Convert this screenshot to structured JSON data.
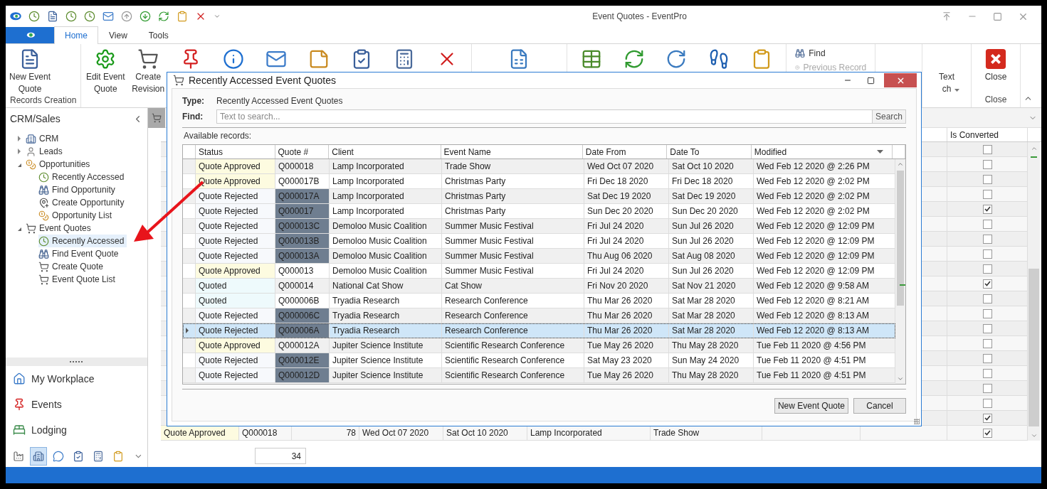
{
  "window": {
    "title": "Event Quotes - EventPro"
  },
  "quick_access": [
    {
      "kind": "logo"
    },
    {
      "kind": "clock"
    },
    {
      "kind": "document"
    },
    {
      "kind": "clock"
    },
    {
      "kind": "clock"
    },
    {
      "kind": "mail"
    },
    {
      "kind": "up-circle"
    },
    {
      "kind": "down-circle"
    },
    {
      "kind": "refresh"
    },
    {
      "kind": "clipboard"
    },
    {
      "kind": "delete"
    },
    {
      "kind": "dropdown"
    }
  ],
  "ribbon_tabs": [
    {
      "label": "Home",
      "selected": true
    },
    {
      "label": "View",
      "selected": false
    },
    {
      "label": "Tools",
      "selected": false
    }
  ],
  "ribbon_groups": [
    {
      "label": "Records Creation",
      "buttons": [
        {
          "kind": "document",
          "lines": [
            "New Event",
            "Quote"
          ]
        }
      ]
    },
    {
      "buttons": [
        {
          "kind": "gear",
          "lines": [
            "Edit Event",
            "Quote"
          ]
        },
        {
          "kind": "cart",
          "lines": [
            "Create",
            "Revision"
          ]
        },
        {
          "kind": "pin"
        },
        {
          "kind": "info"
        },
        {
          "kind": "mail"
        },
        {
          "kind": "note"
        },
        {
          "kind": "clipboard-check"
        },
        {
          "kind": "calculator"
        },
        {
          "kind": "delete"
        }
      ]
    },
    {
      "buttons": [
        {
          "kind": "report"
        }
      ]
    },
    {
      "buttons": [
        {
          "kind": "grid"
        },
        {
          "kind": "refresh"
        },
        {
          "kind": "window-refresh"
        },
        {
          "kind": "footprints"
        },
        {
          "kind": "clipboard"
        }
      ]
    },
    {
      "small_buttons": [
        {
          "kind": "binoculars",
          "label": "Find",
          "disabled": false
        },
        {
          "kind": "previous",
          "label": "Previous Record",
          "disabled": true
        }
      ]
    },
    {
      "buttons": [
        {
          "kind": "none",
          "lines": [
            "Text",
            "ch"
          ],
          "dropdown": true
        }
      ]
    },
    {
      "label": "Close",
      "buttons": [
        {
          "kind": "close-box",
          "lines": [
            "Close"
          ]
        }
      ]
    }
  ],
  "sidebar": {
    "title": "CRM/Sales",
    "tree": [
      {
        "label": "CRM",
        "kind": "building-person",
        "expanded": false,
        "selected": false
      },
      {
        "label": "Leads",
        "kind": "person",
        "expanded": false,
        "selected": false
      },
      {
        "label": "Opportunities",
        "kind": "coins",
        "expanded": true,
        "selected": false,
        "children": [
          {
            "label": "Recently Accessed",
            "kind": "clock",
            "selected": false
          },
          {
            "label": "Find Opportunity",
            "kind": "binoculars",
            "selected": false
          },
          {
            "label": "Create Opportunity",
            "kind": "pin-add",
            "selected": false
          },
          {
            "label": "Opportunity List",
            "kind": "coins",
            "selected": false
          }
        ]
      },
      {
        "label": "Event Quotes",
        "kind": "cart",
        "expanded": true,
        "selected": false,
        "children": [
          {
            "label": "Recently Accessed",
            "kind": "clock",
            "selected": true
          },
          {
            "label": "Find Event Quote",
            "kind": "binoculars",
            "selected": false
          },
          {
            "label": "Create Quote",
            "kind": "cart",
            "selected": false
          },
          {
            "label": "Event Quote List",
            "kind": "cart",
            "selected": false
          }
        ]
      }
    ],
    "nav": [
      {
        "label": "My Workplace",
        "kind": "house"
      },
      {
        "label": "Events",
        "kind": "pin"
      },
      {
        "label": "Lodging",
        "kind": "bed"
      }
    ],
    "icon_bar": [
      {
        "kind": "factory",
        "selected": false
      },
      {
        "kind": "building-person",
        "selected": true
      },
      {
        "kind": "chat",
        "selected": false
      },
      {
        "kind": "clipboard-check",
        "selected": false
      },
      {
        "kind": "calculator",
        "selected": false
      },
      {
        "kind": "clipboard",
        "selected": false
      }
    ]
  },
  "background_grid": {
    "converted_header": "Is Converted",
    "rows": [
      {
        "is_converted": false
      },
      {
        "is_converted": false
      },
      {
        "is_converted": false
      },
      {
        "is_converted": false
      },
      {
        "is_converted": true
      },
      {
        "is_converted": false
      },
      {
        "is_converted": false
      },
      {
        "is_converted": false
      },
      {
        "is_converted": false
      },
      {
        "is_converted": true
      },
      {
        "is_converted": false
      },
      {
        "is_converted": false
      },
      {
        "is_converted": false
      },
      {
        "is_converted": false
      },
      {
        "is_converted": false
      },
      {
        "is_converted": false
      },
      {
        "is_converted": false
      },
      {
        "is_converted": false
      },
      {
        "is_converted": true
      },
      {
        "is_converted": true,
        "kind": "approved",
        "cells": [
          "Quote Approved",
          "Q000018",
          "78",
          "Wed Oct 07 2020",
          "Sat Oct 10 2020",
          "Lamp Incorporated",
          "Trade Show"
        ]
      }
    ],
    "footer_count": "34"
  },
  "dialog": {
    "title": "Recently Accessed Event Quotes",
    "type_label": "Type:",
    "type_value": "Recently Accessed Event Quotes",
    "find_label": "Find:",
    "find_placeholder": "Text to search...",
    "search_button": "Search",
    "records_label": "Available records:",
    "columns": [
      "Status",
      "Quote #",
      "Client",
      "Event Name",
      "Date From",
      "Date To",
      "Modified"
    ],
    "rows": [
      {
        "kind": "approved",
        "selected": false,
        "cells": [
          "Quote Approved",
          "Q000018",
          "Lamp Incorporated",
          "Trade Show",
          "Wed Oct 07 2020",
          "Sat Oct 10 2020",
          "Wed Feb 12 2020 @ 2:26 PM"
        ]
      },
      {
        "kind": "approved",
        "selected": false,
        "cells": [
          "Quote Approved",
          "Q000017B",
          "Lamp Incorporated",
          "Christmas Party",
          "Fri Dec 18 2020",
          "Fri Dec 18 2020",
          "Wed Feb 12 2020 @ 2:02 PM"
        ]
      },
      {
        "kind": "rejected",
        "selected": false,
        "cells": [
          "Quote Rejected",
          "Q000017A",
          "Lamp Incorporated",
          "Christmas Party",
          "Sat Dec 19 2020",
          "Sat Dec 19 2020",
          "Wed Feb 12 2020 @ 2:02 PM"
        ]
      },
      {
        "kind": "rejected",
        "selected": false,
        "cells": [
          "Quote Rejected",
          "Q000017",
          "Lamp Incorporated",
          "Christmas Party",
          "Sun Dec 20 2020",
          "Sun Dec 20 2020",
          "Wed Feb 12 2020 @ 2:02 PM"
        ]
      },
      {
        "kind": "rejected",
        "selected": false,
        "cells": [
          "Quote Rejected",
          "Q000013C",
          "Demoloo Music Coalition",
          "Summer Music Festival",
          "Fri Jul 24 2020",
          "Sun Jul 26 2020",
          "Wed Feb 12 2020 @ 12:09 PM"
        ]
      },
      {
        "kind": "rejected",
        "selected": false,
        "cells": [
          "Quote Rejected",
          "Q000013B",
          "Demoloo Music Coalition",
          "Summer Music Festival",
          "Fri Jul 24 2020",
          "Sun Jul 26 2020",
          "Wed Feb 12 2020 @ 12:09 PM"
        ]
      },
      {
        "kind": "rejected",
        "selected": false,
        "cells": [
          "Quote Rejected",
          "Q000013A",
          "Demoloo Music Coalition",
          "Summer Music Festival",
          "Thu Aug 06 2020",
          "Sat Aug 08 2020",
          "Wed Feb 12 2020 @ 12:09 PM"
        ]
      },
      {
        "kind": "approved",
        "selected": false,
        "cells": [
          "Quote Approved",
          "Q000013",
          "Demoloo Music Coalition",
          "Summer Music Festival",
          "Fri Jul 24 2020",
          "Sun Jul 26 2020",
          "Wed Feb 12 2020 @ 12:09 PM"
        ]
      },
      {
        "kind": "quoted",
        "selected": false,
        "cells": [
          "Quoted",
          "Q000014",
          "National Cat Show",
          "Cat Show",
          "Fri Nov 20 2020",
          "Sat Nov 21 2020",
          "Wed Feb 12 2020 @ 9:58 AM"
        ]
      },
      {
        "kind": "quoted",
        "selected": false,
        "cells": [
          "Quoted",
          "Q000006B",
          "Tryadia Research",
          "Research Conference",
          "Thu Mar 26 2020",
          "Sat Mar 28 2020",
          "Wed Feb 12 2020 @ 8:21 AM"
        ]
      },
      {
        "kind": "rejected",
        "selected": false,
        "cells": [
          "Quote Rejected",
          "Q000006C",
          "Tryadia Research",
          "Research Conference",
          "Thu Mar 26 2020",
          "Sat Mar 28 2020",
          "Wed Feb 12 2020 @ 8:13 AM"
        ]
      },
      {
        "kind": "rejected",
        "selected": true,
        "cells": [
          "Quote Rejected",
          "Q000006A",
          "Tryadia Research",
          "Research Conference",
          "Thu Mar 26 2020",
          "Sat Mar 28 2020",
          "Wed Feb 12 2020 @ 8:13 AM"
        ]
      },
      {
        "kind": "approved",
        "selected": false,
        "cells": [
          "Quote Approved",
          "Q000012A",
          "Jupiter Science Institute",
          "Scientific Research Conference",
          "Tue May 26 2020",
          "Thu May 28 2020",
          "Tue Feb 11 2020 @ 4:56 PM"
        ]
      },
      {
        "kind": "rejected",
        "selected": false,
        "cells": [
          "Quote Rejected",
          "Q000012E",
          "Jupiter Science Institute",
          "Scientific Research Conference",
          "Sat May 23 2020",
          "Sun May 24 2020",
          "Tue Feb 11 2020 @ 4:51 PM"
        ]
      },
      {
        "kind": "rejected",
        "selected": false,
        "cells": [
          "Quote Rejected",
          "Q000012D",
          "Jupiter Science Institute",
          "Scientific Research Conference",
          "Tue May 26 2020",
          "Thu May 28 2020",
          "Tue Feb 11 2020 @ 4:51 PM"
        ]
      }
    ],
    "buttons": [
      "New Event Quote",
      "Cancel"
    ]
  }
}
